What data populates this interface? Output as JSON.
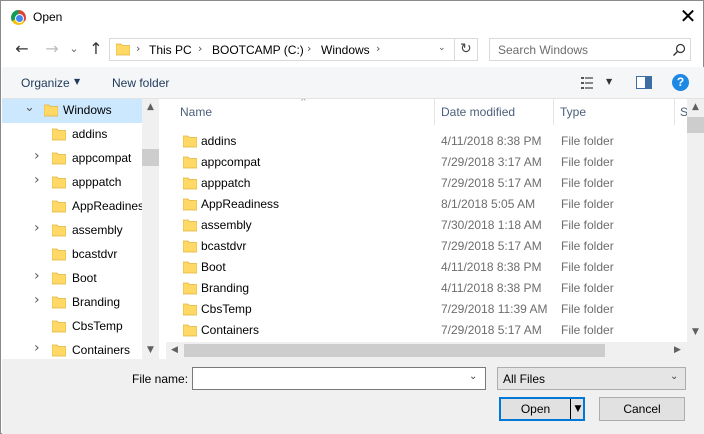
{
  "window": {
    "title": "Open",
    "close_glyph": "✕"
  },
  "nav": {
    "back_glyph": "←",
    "forward_glyph": "→",
    "recent_glyph": "⌄",
    "up_glyph": "↑",
    "refresh_glyph": "↻"
  },
  "address": {
    "crumbs": [
      "This PC",
      "BOOTCAMP (C:)",
      "Windows"
    ],
    "separator": "›"
  },
  "search": {
    "placeholder": "Search Windows"
  },
  "toolbar": {
    "organize_label": "Organize",
    "new_folder_label": "New folder",
    "help_glyph": "?"
  },
  "tree": {
    "items": [
      {
        "label": "Windows",
        "selected": true,
        "expanded": true
      },
      {
        "label": "addins",
        "has_children": false
      },
      {
        "label": "appcompat",
        "has_children": true
      },
      {
        "label": "apppatch",
        "has_children": true
      },
      {
        "label": "AppReadines",
        "has_children": false
      },
      {
        "label": "assembly",
        "has_children": true
      },
      {
        "label": "bcastdvr",
        "has_children": false
      },
      {
        "label": "Boot",
        "has_children": true
      },
      {
        "label": "Branding",
        "has_children": true
      },
      {
        "label": "CbsTemp",
        "has_children": false
      },
      {
        "label": "Containers",
        "has_children": true
      }
    ]
  },
  "list": {
    "columns": {
      "name": "Name",
      "date": "Date modified",
      "type": "Type",
      "size": "S"
    },
    "rows": [
      {
        "name": "addins",
        "date": "4/11/2018 8:38 PM",
        "type": "File folder"
      },
      {
        "name": "appcompat",
        "date": "7/29/2018 3:17 AM",
        "type": "File folder"
      },
      {
        "name": "apppatch",
        "date": "7/29/2018 5:17 AM",
        "type": "File folder"
      },
      {
        "name": "AppReadiness",
        "date": "8/1/2018 5:05 AM",
        "type": "File folder"
      },
      {
        "name": "assembly",
        "date": "7/30/2018 1:18 AM",
        "type": "File folder"
      },
      {
        "name": "bcastdvr",
        "date": "7/29/2018 5:17 AM",
        "type": "File folder"
      },
      {
        "name": "Boot",
        "date": "4/11/2018 8:38 PM",
        "type": "File folder"
      },
      {
        "name": "Branding",
        "date": "4/11/2018 8:38 PM",
        "type": "File folder"
      },
      {
        "name": "CbsTemp",
        "date": "7/29/2018 11:39 AM",
        "type": "File folder"
      },
      {
        "name": "Containers",
        "date": "7/29/2018 5:17 AM",
        "type": "File folder"
      }
    ]
  },
  "footer": {
    "file_name_label": "File name:",
    "file_name_value": "",
    "filter_value": "All Files",
    "open_label": "Open",
    "cancel_label": "Cancel"
  },
  "colors": {
    "selection": "#cce8ff",
    "accent": "#0078d7",
    "folder": "#ffd866",
    "help": "#1e88e5"
  }
}
